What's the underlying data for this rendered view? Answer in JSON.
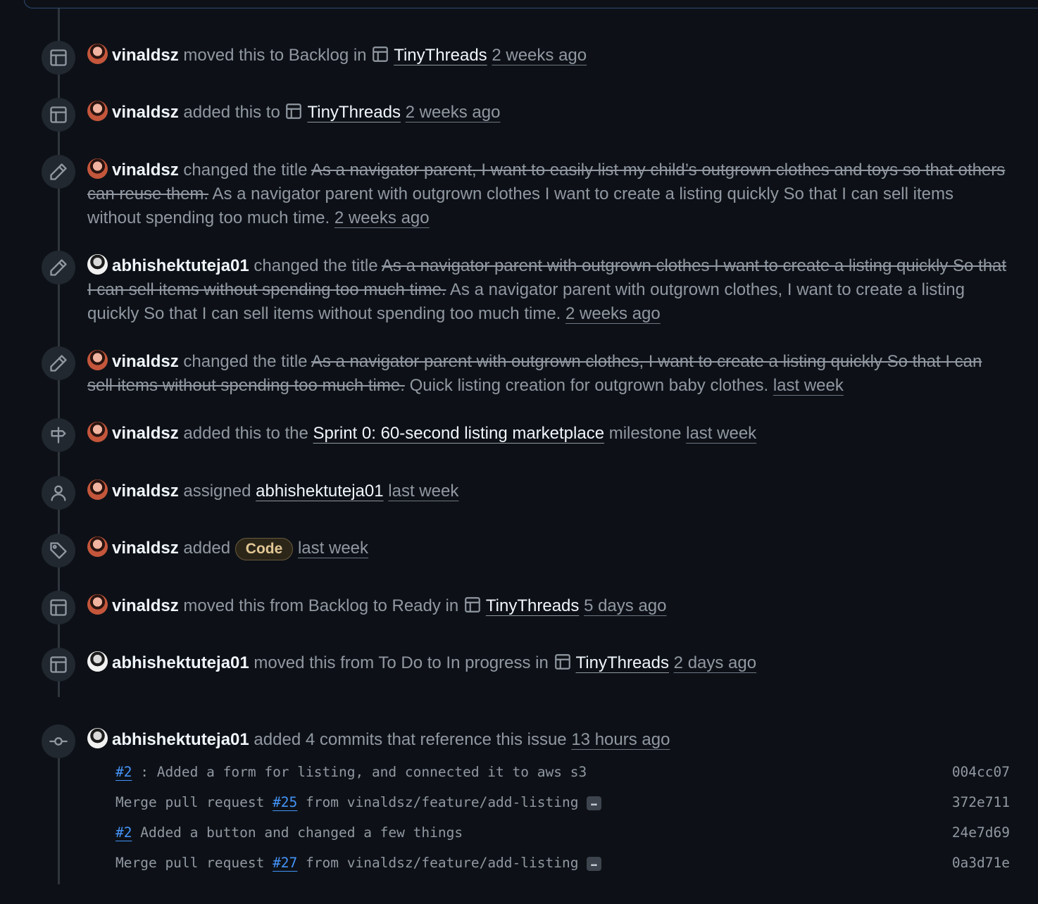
{
  "events": [
    {
      "icon": "project-board-icon",
      "user": "vinaldsz",
      "avatar": "v",
      "pre": "moved this to Backlog in",
      "project": "TinyThreads",
      "time": "2 weeks ago"
    },
    {
      "icon": "project-board-icon",
      "user": "vinaldsz",
      "avatar": "v",
      "pre": "added this to",
      "project": "TinyThreads",
      "time": "2 weeks ago"
    },
    {
      "icon": "pencil-icon",
      "user": "vinaldsz",
      "avatar": "v",
      "pre": "changed the title",
      "old_title": "As a navigator parent, I want to easily list my child’s outgrown clothes and toys so that others can reuse them.",
      "new_title": "As a navigator parent with outgrown clothes I want to create a listing quickly So that I can sell items without spending too much time.",
      "time": "2 weeks ago"
    },
    {
      "icon": "pencil-icon",
      "user": "abhishektuteja01",
      "avatar": "a",
      "pre": "changed the title",
      "old_title": "As a navigator parent with outgrown clothes I want to create a listing quickly So that I can sell items without spending too much time.",
      "new_title": "As a navigator parent with outgrown clothes, I want to create a listing quickly So that I can sell items without spending too much time.",
      "time": "2 weeks ago"
    },
    {
      "icon": "pencil-icon",
      "user": "vinaldsz",
      "avatar": "v",
      "pre": "changed the title",
      "old_title": "As a navigator parent with outgrown clothes, I want to create a listing quickly So that I can sell items without spending too much time.",
      "new_title": "Quick listing creation for outgrown baby clothes.",
      "time": "last week"
    },
    {
      "icon": "milestone-icon",
      "user": "vinaldsz",
      "avatar": "v",
      "pre": "added this to the",
      "milestone": "Sprint 0: 60-second listing marketplace",
      "post": "milestone",
      "time": "last week"
    },
    {
      "icon": "person-icon",
      "user": "vinaldsz",
      "avatar": "v",
      "pre": "assigned",
      "assignee": "abhishektuteja01",
      "time": "last week"
    },
    {
      "icon": "tag-icon",
      "user": "vinaldsz",
      "avatar": "v",
      "pre": "added",
      "label": "Code",
      "time": "last week"
    },
    {
      "icon": "project-board-icon",
      "user": "vinaldsz",
      "avatar": "v",
      "pre": "moved this from Backlog to Ready in",
      "project": "TinyThreads",
      "time": "5 days ago"
    },
    {
      "icon": "project-board-icon",
      "user": "abhishektuteja01",
      "avatar": "a",
      "pre": "moved this from To Do to In progress in",
      "project": "TinyThreads",
      "time": "2 days ago"
    },
    {
      "icon": "git-commit-icon",
      "user": "abhishektuteja01",
      "avatar": "a",
      "pre": "added 4 commits that reference this issue",
      "time": "13 hours ago"
    }
  ],
  "commits": [
    {
      "issue": "#2",
      "text_before": "",
      "text_after": " : Added a form for listing, and connected it to aws s3",
      "sha": "004cc07",
      "has_more": false
    },
    {
      "issue": "#25",
      "text_before": "Merge pull request ",
      "text_after": " from vinaldsz/feature/add-listing",
      "sha": "372e711",
      "has_more": true
    },
    {
      "issue": "#2",
      "text_before": "",
      "text_after": " Added a button and changed a few things",
      "sha": "24e7d69",
      "has_more": false
    },
    {
      "issue": "#27",
      "text_before": "Merge pull request ",
      "text_after": " from vinaldsz/feature/add-listing",
      "sha": "0a3d71e",
      "has_more": true
    }
  ],
  "more_label": "…"
}
